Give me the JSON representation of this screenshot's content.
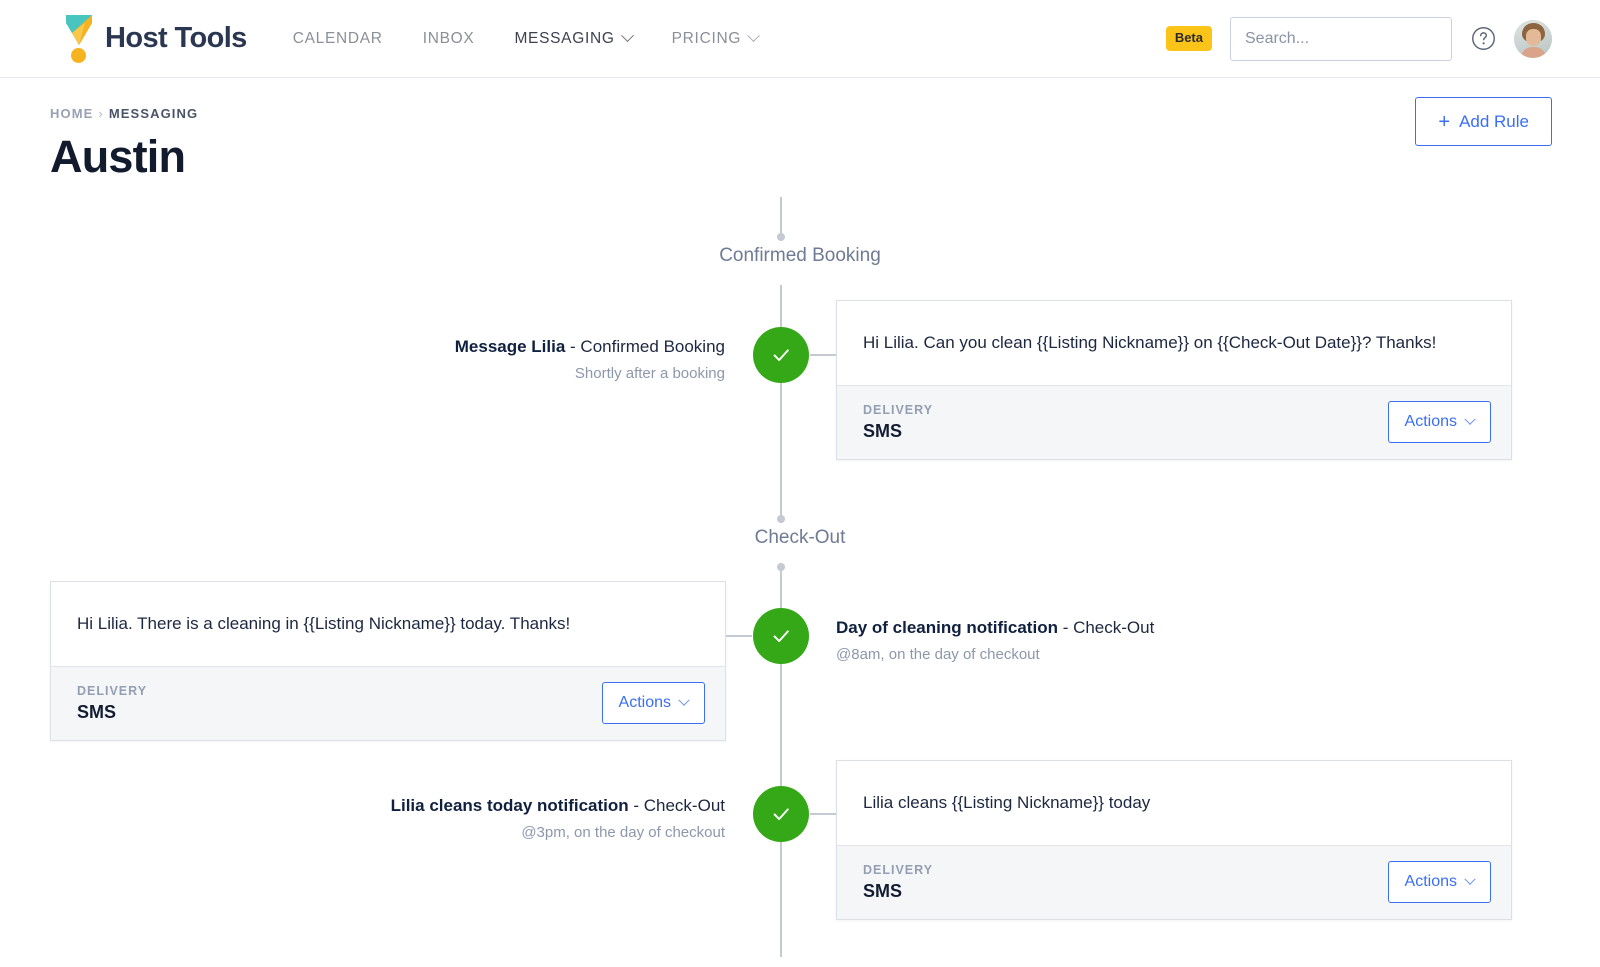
{
  "header": {
    "brand": "Host Tools",
    "logo_icon": "host-tools-logo",
    "nav": [
      {
        "label": "CALENDAR",
        "has_chevron": false,
        "active": false
      },
      {
        "label": "INBOX",
        "has_chevron": false,
        "active": false
      },
      {
        "label": "MESSAGING",
        "has_chevron": true,
        "active": true
      },
      {
        "label": "PRICING",
        "has_chevron": true,
        "active": false
      }
    ],
    "beta_badge": "Beta",
    "search": {
      "placeholder": "Search...",
      "value": "",
      "icon": "search-icon"
    },
    "help_icon": "question-circle-icon",
    "avatar_icon": "user-avatar"
  },
  "page": {
    "breadcrumb": {
      "home": "HOME",
      "separator": "›",
      "current": "MESSAGING"
    },
    "title": "Austin",
    "add_rule": {
      "label": "Add Rule",
      "plus": "+"
    }
  },
  "timeline": {
    "sections": [
      {
        "label": "Confirmed Booking"
      },
      {
        "label": "Check-Out"
      }
    ],
    "rules": [
      {
        "name": "Message Lilia",
        "dash": " - ",
        "trigger": "Confirmed Booking",
        "timing": "Shortly after a booking",
        "side": "right",
        "status_icon": "check-circle-icon",
        "status_color": "#34a816",
        "message": "Hi Lilia. Can you clean {{Listing Nickname}} on {{Check-Out Date}}?  Thanks!",
        "delivery_label": "DELIVERY",
        "delivery_value": "SMS",
        "actions_label": "Actions"
      },
      {
        "name": "Day of cleaning notification",
        "dash": " - ",
        "trigger": "Check-Out",
        "timing": "@8am, on the day of checkout",
        "side": "left",
        "status_icon": "check-circle-icon",
        "status_color": "#34a816",
        "message": "Hi Lilia. There is a cleaning in {{Listing Nickname}} today. Thanks!",
        "delivery_label": "DELIVERY",
        "delivery_value": "SMS",
        "actions_label": "Actions"
      },
      {
        "name": "Lilia cleans today notification",
        "dash": " - ",
        "trigger": "Check-Out",
        "timing": "@3pm, on the day of checkout",
        "side": "right",
        "status_icon": "check-circle-icon",
        "status_color": "#34a816",
        "message": "Lilia cleans {{Listing Nickname}} today",
        "delivery_label": "DELIVERY",
        "delivery_value": "SMS",
        "actions_label": "Actions"
      }
    ]
  },
  "colors": {
    "accent_blue": "#3b6ef5",
    "status_green": "#34a816",
    "beta_yellow": "#fcc419",
    "logo_teal": "#49c5c0",
    "logo_orange": "#f6b320",
    "title_navy": "#121a2e",
    "muted_text": "#8d97ab",
    "line_gray": "#c4c9d2"
  }
}
